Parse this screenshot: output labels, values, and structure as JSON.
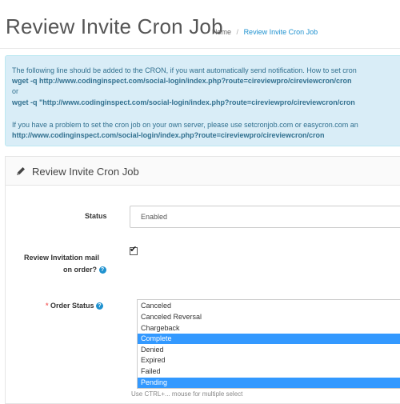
{
  "header": {
    "title": "Review Invite Cron Job",
    "breadcrumb": {
      "home": "Home",
      "separator": "/",
      "current": "Review Invite Cron Job"
    }
  },
  "alert": {
    "intro": "The following line should be added to the CRON, if you want automatically send notification. How to set cron",
    "wget_line": "wget -q http://www.codinginspect.com/social-login/index.php?route=cireviewpro/cireviewcron/cron",
    "or": "or",
    "wget_line_quoted": "wget -q \"http://www.codinginspect.com/social-login/index.php?route=cireviewpro/cireviewcron/cron",
    "problem": "If you have a problem to set the cron job on your own server, please use setcronjob.com or easycron.com an",
    "url_line": "http://www.codinginspect.com/social-login/index.php?route=cireviewpro/cireviewcron/cron"
  },
  "panel": {
    "title": "Review Invite Cron Job",
    "status_label": "Status",
    "status_value": "Enabled",
    "mail_label_line1": "Review Invitation mail",
    "mail_label_line2": "on order?",
    "mail_checked": true,
    "order_status_label": "Order Status",
    "required_mark": "*",
    "help_glyph": "?",
    "order_status_options": [
      {
        "label": "Canceled",
        "selected": false
      },
      {
        "label": "Canceled Reversal",
        "selected": false
      },
      {
        "label": "Chargeback",
        "selected": false
      },
      {
        "label": "Complete",
        "selected": true
      },
      {
        "label": "Denied",
        "selected": false
      },
      {
        "label": "Expired",
        "selected": false
      },
      {
        "label": "Failed",
        "selected": false
      },
      {
        "label": "Pending",
        "selected": true
      }
    ],
    "help_text": "Use CTRL+... mouse for multiple select"
  },
  "colors": {
    "accent": "#1e91cf",
    "alert_bg": "#d9edf7",
    "selected_bg": "#3399ff",
    "required": "#f56b6b"
  },
  "icons": {
    "panel_icon": "pencil-icon",
    "help_icon": "question-circle-icon",
    "check_icon": "checkmark-icon"
  }
}
